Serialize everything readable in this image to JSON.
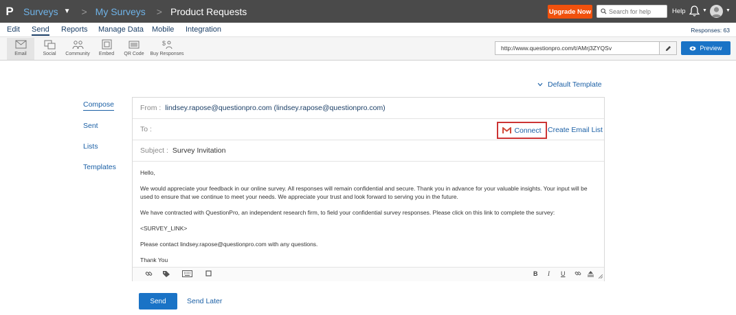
{
  "topbar": {
    "logo": "P",
    "breadcrumbs": [
      "Surveys",
      "My Surveys",
      "Product Requests"
    ],
    "separator": ">",
    "upgrade_label": "Upgrade Now",
    "search_placeholder": "Search for help",
    "help_label": "Help"
  },
  "menubar": {
    "items": [
      "Edit",
      "Send",
      "Reports",
      "Manage Data",
      "Mobile",
      "Integration"
    ],
    "active": "Send",
    "responses": "Responses: 63"
  },
  "toolbar": {
    "tools": [
      "Email",
      "Social",
      "Community",
      "Embed",
      "QR Code",
      "Buy Responses"
    ],
    "active": "Email",
    "survey_url": "http://www.questionpro.com/t/AMrj3ZYQSv",
    "preview_label": "Preview"
  },
  "template": {
    "label": "Default Template"
  },
  "sidenav": {
    "items": [
      "Compose",
      "Sent",
      "Lists",
      "Templates"
    ],
    "active": "Compose"
  },
  "compose": {
    "from_label": "From :",
    "from_value": "lindsey.rapose@questionpro.com (lindsey.rapose@questionpro.com)",
    "to_label": "To :",
    "connect_label": "Connect",
    "create_list_label": "Create Email List",
    "subject_label": "Subject :",
    "subject_value": "Survey Invitation",
    "body": [
      "Hello,",
      "We would appreciate your feedback in our online survey.  All responses will remain confidential and secure.  Thank you in advance for your valuable insights.  Your input will be used to ensure that we continue to meet your needs. We appreciate your trust and look forward to serving you in the future.",
      "We have contracted with QuestionPro, an independent research firm, to field your confidential survey responses.  Please click on this link to complete the survey:",
      "<SURVEY_LINK>",
      "Please contact lindsey.rapose@questionpro.com with any questions.",
      "Thank You"
    ],
    "format_buttons": [
      "B",
      "I",
      "U"
    ]
  },
  "actions": {
    "send_label": "Send",
    "send_later_label": "Send Later"
  },
  "colors": {
    "topbar": "#4a4a4a",
    "accent": "#1a73c6",
    "upgrade": "#f0510d",
    "highlight": "#cc3333"
  }
}
